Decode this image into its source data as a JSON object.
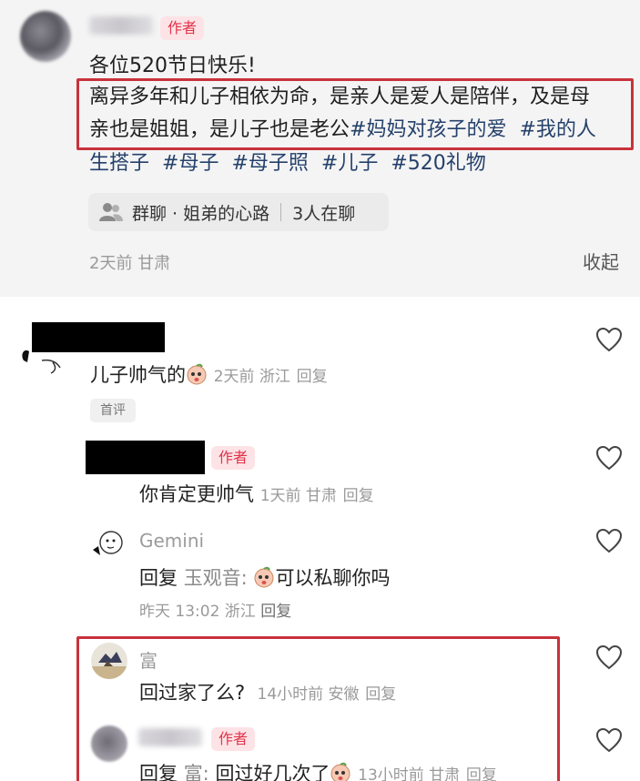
{
  "post": {
    "author_tag": "作者",
    "greeting": "各位520节日快乐!",
    "body_lines": [
      "离异多年和儿子相依为命，是亲人是爱人是陪伴，及是母",
      "亲也是姐姐，是儿子也是老公",
      "生搭子"
    ],
    "tags_line2": [
      "#妈妈对孩子的爱",
      "#我的人"
    ],
    "tags_line3": [
      "#母子",
      "#母子照",
      "#儿子",
      "#520礼物"
    ],
    "group_chat": {
      "label": "群聊 · 姐弟的心路",
      "count": "3人在聊"
    },
    "time_location": "2天前 甘肃",
    "collapse_label": "收起"
  },
  "comments": [
    {
      "text": "儿子帅气的",
      "meta": "2天前 浙江",
      "reply_label": "回复",
      "badge": "首评"
    },
    {
      "author_tag": "作者",
      "text": "你肯定更帅气",
      "meta": "1天前 甘肃",
      "reply_label": "回复"
    },
    {
      "name": "Gemini",
      "reply_prefix": "回复",
      "reply_target": "玉观音:",
      "text": "可以私聊你吗",
      "meta": "昨天 13:02 浙江",
      "reply_label": "回复"
    },
    {
      "name": "富",
      "text": "回过家了么?",
      "meta": "14小时前 安徽",
      "reply_label": "回复"
    },
    {
      "author_tag": "作者",
      "reply_prefix": "回复",
      "reply_target": "富:",
      "text": "回过好几次了",
      "meta": "13小时前 甘肃",
      "reply_label": "回复"
    }
  ],
  "icons": {
    "like": "heart-outline-icon",
    "group": "group-chat-icon",
    "emoji": "peach-face-emoji"
  },
  "colors": {
    "author_tag_bg": "#fde3e6",
    "author_tag_text": "#e0344a",
    "hashtag": "#25416b",
    "highlight_frame": "#c8323c"
  }
}
